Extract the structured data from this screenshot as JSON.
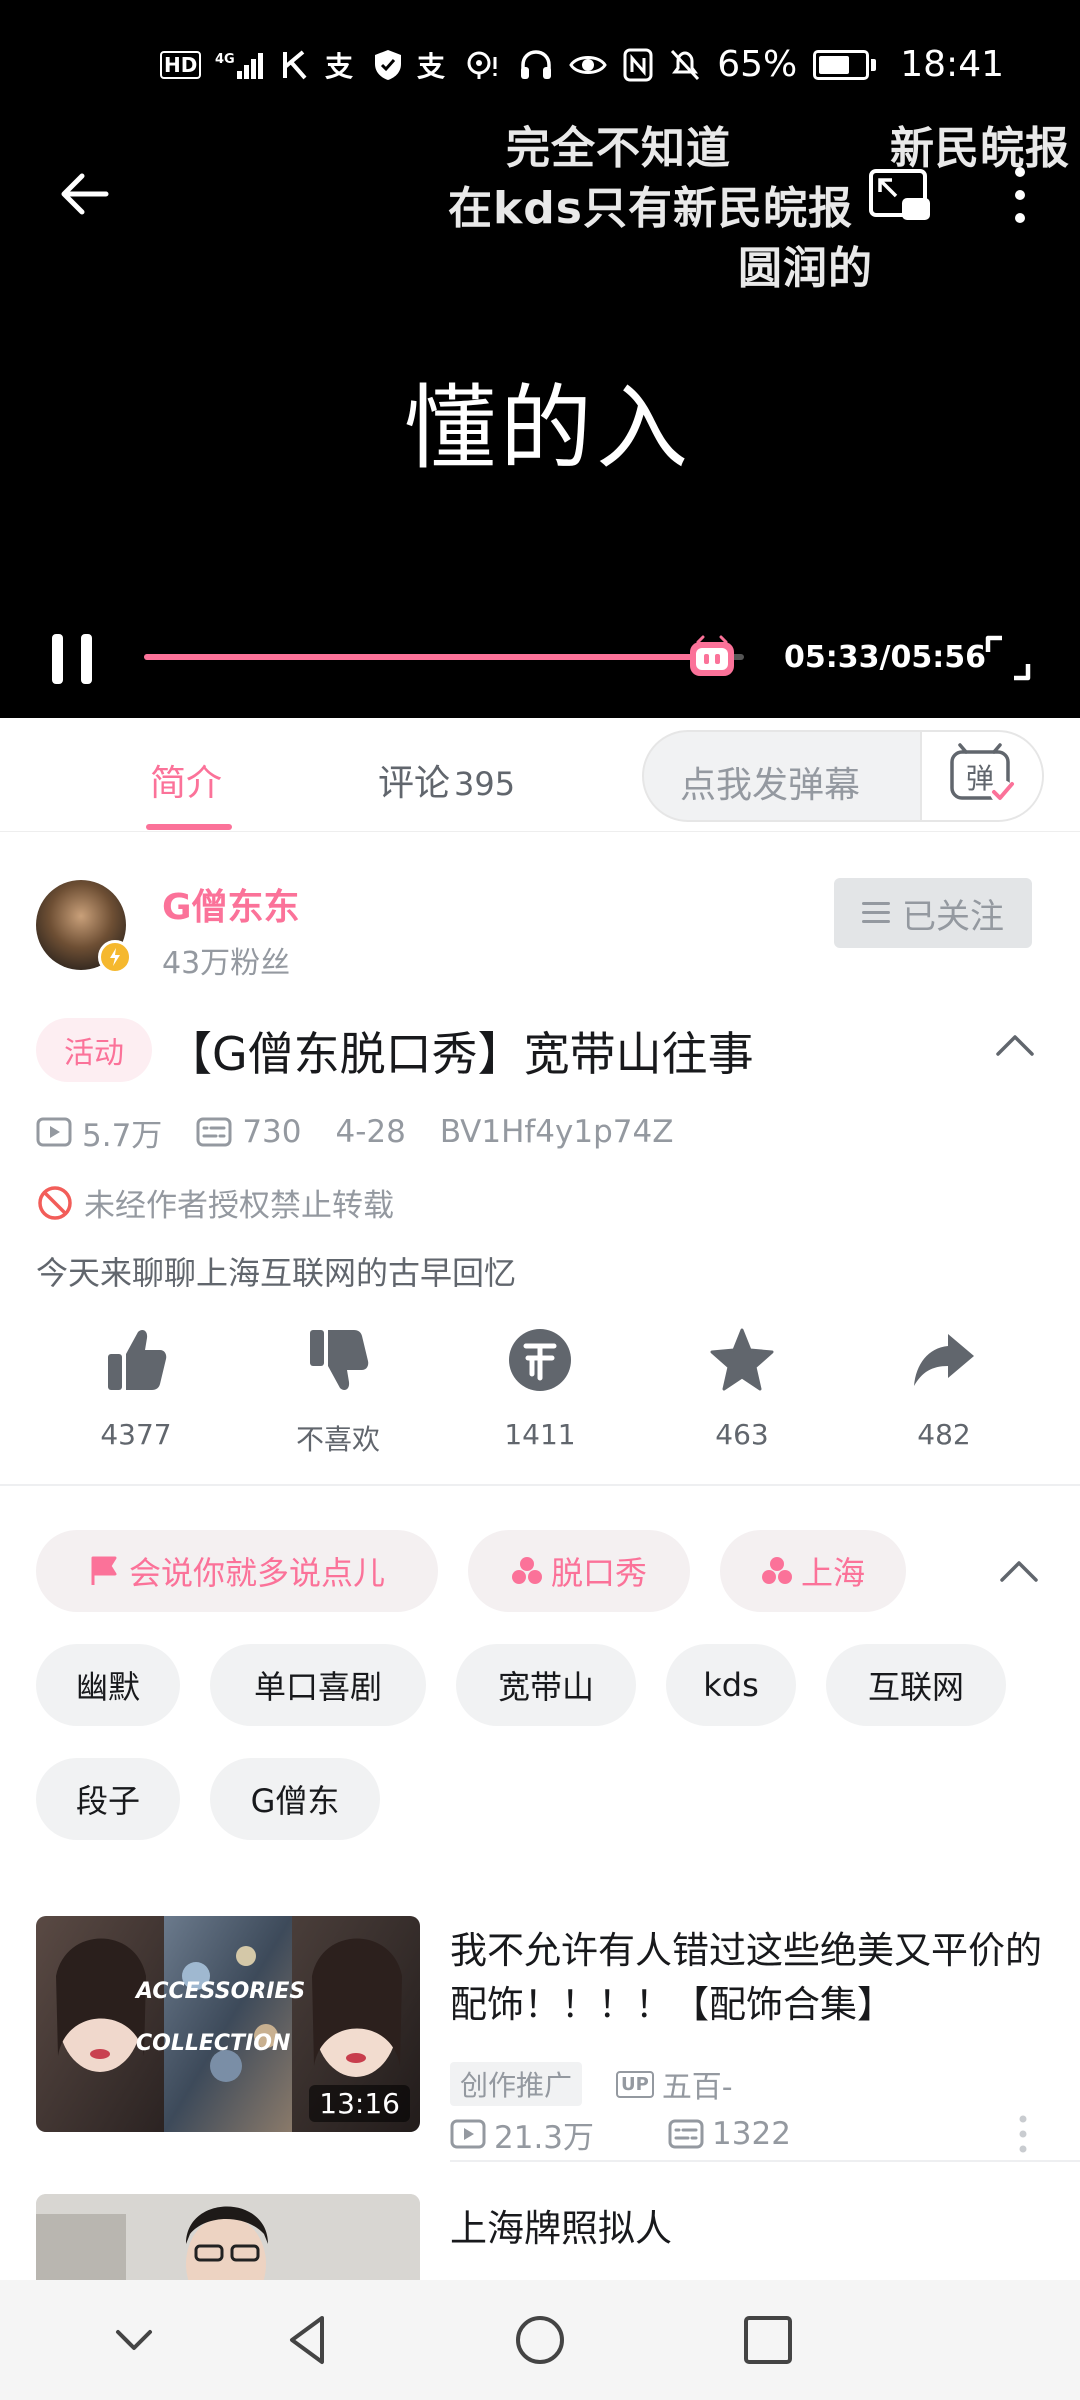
{
  "status_bar": {
    "left_icons": [
      "hd-icon",
      "4g-signal-icon",
      "k-app-icon",
      "alipay-icon",
      "shield-icon",
      "alipay-icon",
      "location-icon"
    ],
    "hd": "HD",
    "battery": "65%",
    "time": "18:41"
  },
  "player": {
    "danmaku": [
      "完全不知道",
      "新民皖报",
      "在kds只有新民皖报",
      "圆润的"
    ],
    "subtitle": "懂的入",
    "time": "05:33/05:56",
    "progress": 0.947,
    "accent": "#fb7299"
  },
  "tabs": {
    "intro": "简介",
    "comments": "评论",
    "comments_count": "395",
    "danmaku_placeholder": "点我发弹幕",
    "danmaku_toggle": "弹"
  },
  "uploader": {
    "name": "G僧东东",
    "fans": "43万粉丝",
    "follow": "已关注"
  },
  "video": {
    "tag": "活动",
    "title": "【G僧东脱口秀】宽带山往事",
    "views": "5.7万",
    "danmaku": "730",
    "date": "4-28",
    "bvid": "BV1Hf4y1p74Z",
    "copyright": "未经作者授权禁止转载",
    "description": "今天来聊聊上海互联网的古早回忆"
  },
  "actions": [
    {
      "icon": "thumbs-up-icon",
      "label": "4377"
    },
    {
      "icon": "thumbs-down-icon",
      "label": "不喜欢"
    },
    {
      "icon": "coin-icon",
      "label": "1411"
    },
    {
      "icon": "star-icon",
      "label": "463"
    },
    {
      "icon": "share-icon",
      "label": "482"
    }
  ],
  "tags": {
    "featured": [
      "会说你就多说点儿",
      "脱口秀",
      "上海"
    ],
    "regular": [
      "幽默",
      "单口喜剧",
      "宽带山",
      "kds",
      "互联网",
      "段子",
      "G僧东"
    ]
  },
  "recommendations": [
    {
      "title": "我不允许有人错过这些绝美又平价的配饰！！！！【配饰合集】",
      "thumb_text_1": "ACCESSORIES",
      "thumb_text_2": "COLLECTION",
      "duration": "13:16",
      "promo": "创作推广",
      "up_badge": "UP",
      "uploader": "五百-",
      "views": "21.3万",
      "danmaku": "1322"
    },
    {
      "title": "上海牌照拟人"
    }
  ]
}
